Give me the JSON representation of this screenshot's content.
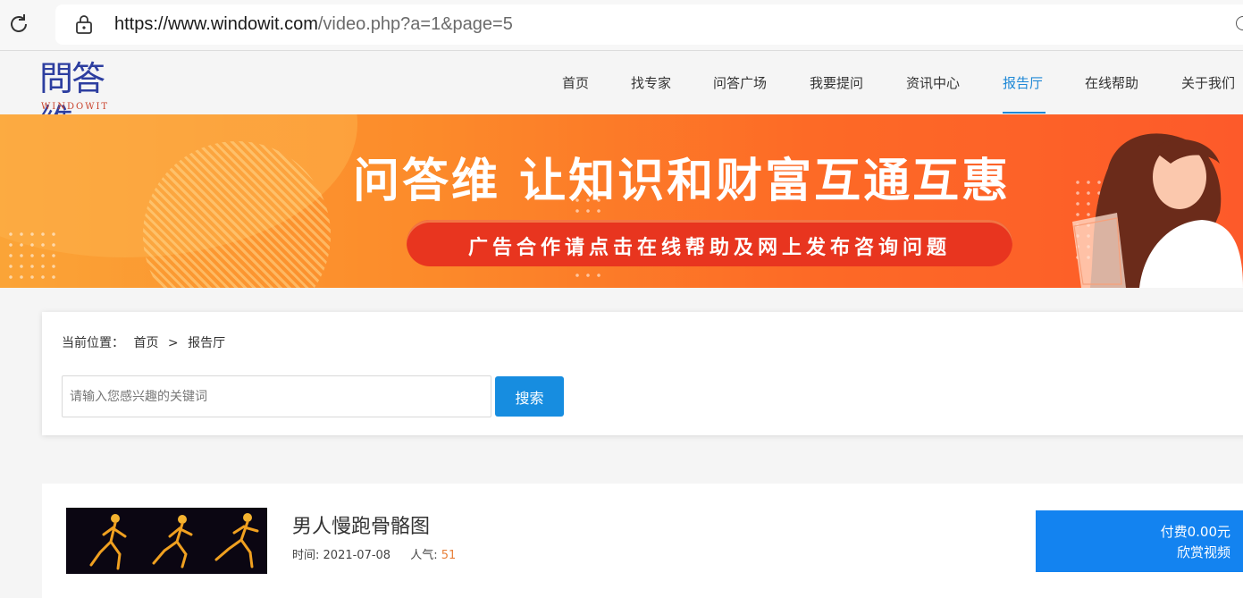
{
  "browser": {
    "url_host": "https://www.windowit.com",
    "url_path": "/video.php?a=1&page=5"
  },
  "logo": {
    "cn": "問答維",
    "en": "WINDOWIT"
  },
  "nav": {
    "items": [
      "首页",
      "找专家",
      "问答广场",
      "我要提问",
      "资讯中心",
      "报告厅",
      "在线帮助",
      "关于我们"
    ],
    "active": "报告厅"
  },
  "banner": {
    "title": "问答维 让知识和财富互通互惠",
    "subtitle": "广告合作请点击在线帮助及网上发布咨询问题"
  },
  "breadcrumb": {
    "label": "当前位置：",
    "home": "首页",
    "separator": ">",
    "current": "报告厅"
  },
  "search": {
    "placeholder": "请输入您感兴趣的关键词",
    "button": "搜索"
  },
  "videos": [
    {
      "title": "男人慢跑骨骼图",
      "time_label": "时间:",
      "time": "2021-07-08",
      "popularity_label": "人气:",
      "popularity": "51",
      "price_label": "付费0.00元",
      "action_label": "欣赏视频"
    }
  ],
  "colors": {
    "accent": "#1e88d6",
    "button": "#178de0",
    "pay_button": "#1383f0",
    "banner_start": "#fba437",
    "banner_end": "#fd5a2a",
    "popularity": "#e8803a"
  }
}
